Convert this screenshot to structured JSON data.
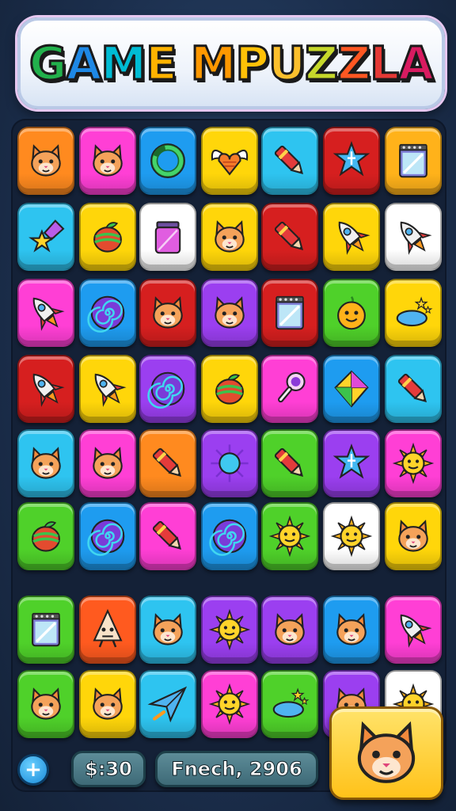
{
  "title": {
    "text": "GAME MPUZZLA",
    "letter_colors": [
      "#22b14c",
      "#1e88e5",
      "#00bcd4",
      "#ffb300",
      "#ff9800",
      "#ffc107",
      "#fbc02d",
      "#c6d82b",
      "#ff5722",
      "#e53935",
      "#d81b60",
      "#c62828"
    ]
  },
  "grid": {
    "columns": 7,
    "rows": [
      [
        {
          "color": "#ff8a1f",
          "icon": "cat-face-icon"
        },
        {
          "color": "#ff3fd5",
          "icon": "cat-face-icon"
        },
        {
          "color": "#1e9cf0",
          "icon": "swirl-ring-icon"
        },
        {
          "color": "#ffd60a",
          "icon": "winged-heart-icon"
        },
        {
          "color": "#2ec4f0",
          "icon": "crayon-icon"
        },
        {
          "color": "#d61f1f",
          "icon": "star-badge-icon"
        },
        {
          "color": "#ffb21a",
          "icon": "notepad-icon"
        }
      ],
      [
        {
          "color": "#2ec4f0",
          "icon": "shooting-star-icon"
        },
        {
          "color": "#ffd60a",
          "icon": "striped-fruit-icon"
        },
        {
          "color": "#ffffff",
          "icon": "jar-icon"
        },
        {
          "color": "#ffd60a",
          "icon": "cat-face-icon"
        },
        {
          "color": "#d61f1f",
          "icon": "crayon-icon"
        },
        {
          "color": "#ffd60a",
          "icon": "rocket-icon"
        },
        {
          "color": "#ffffff",
          "icon": "rocket-icon"
        }
      ],
      [
        {
          "color": "#ff3fd5",
          "icon": "rocket-icon"
        },
        {
          "color": "#1e9cf0",
          "icon": "spiral-icon"
        },
        {
          "color": "#d61f1f",
          "icon": "cat-face-icon"
        },
        {
          "color": "#9b3ff0",
          "icon": "cat-face-icon"
        },
        {
          "color": "#d61f1f",
          "icon": "notepad-icon"
        },
        {
          "color": "#4fd12a",
          "icon": "smiley-sprout-icon"
        },
        {
          "color": "#ffd60a",
          "icon": "cloud-stars-icon"
        }
      ],
      [
        {
          "color": "#d61f1f",
          "icon": "rocket-icon"
        },
        {
          "color": "#ffd60a",
          "icon": "rocket-icon"
        },
        {
          "color": "#9b3ff0",
          "icon": "spiral-icon"
        },
        {
          "color": "#ffd60a",
          "icon": "striped-fruit-icon"
        },
        {
          "color": "#ff3fd5",
          "icon": "rattle-icon"
        },
        {
          "color": "#1e9cf0",
          "icon": "kite-icon"
        },
        {
          "color": "#2ec4f0",
          "icon": "crayon-icon"
        }
      ],
      [
        {
          "color": "#2ec4f0",
          "icon": "cat-face-icon"
        },
        {
          "color": "#ff3fd5",
          "icon": "cat-face-icon"
        },
        {
          "color": "#ff8a1f",
          "icon": "crayon-icon"
        },
        {
          "color": "#9b3ff0",
          "icon": "sun-ball-icon"
        },
        {
          "color": "#4fd12a",
          "icon": "crayon-icon"
        },
        {
          "color": "#9b3ff0",
          "icon": "star-badge-icon"
        },
        {
          "color": "#ff3fd5",
          "icon": "sun-face-icon"
        }
      ],
      [
        {
          "color": "#4fd12a",
          "icon": "striped-fruit-icon"
        },
        {
          "color": "#1e9cf0",
          "icon": "spiral-icon"
        },
        {
          "color": "#ff3fd5",
          "icon": "crayon-icon"
        },
        {
          "color": "#1e9cf0",
          "icon": "spiral-icon"
        },
        {
          "color": "#4fd12a",
          "icon": "sun-face-icon"
        },
        {
          "color": "#ffffff",
          "icon": "sun-face-icon"
        },
        {
          "color": "#ffd60a",
          "icon": "cat-face-icon"
        }
      ],
      [
        {
          "color": "#4fd12a",
          "icon": "notepad-icon"
        },
        {
          "color": "#ff5a1f",
          "icon": "arrowhead-face-icon"
        },
        {
          "color": "#2ec4f0",
          "icon": "cat-face-icon"
        },
        {
          "color": "#9b3ff0",
          "icon": "sun-face-icon"
        },
        {
          "color": "#9b3ff0",
          "icon": "cat-face-icon"
        },
        {
          "color": "#1e9cf0",
          "icon": "cat-face-icon"
        },
        {
          "color": "#ff3fd5",
          "icon": "rocket-icon"
        }
      ],
      [
        {
          "color": "#4fd12a",
          "icon": "cat-face-icon"
        },
        {
          "color": "#ffd60a",
          "icon": "cat-face-icon"
        },
        {
          "color": "#2ec4f0",
          "icon": "paper-plane-icon"
        },
        {
          "color": "#ff3fd5",
          "icon": "sun-face-icon"
        },
        {
          "color": "#4fd12a",
          "icon": "cloud-stars-icon"
        },
        {
          "color": "#9b3ff0",
          "icon": "cat-face-icon"
        },
        {
          "color": "#ffffff",
          "icon": "sun-face-icon"
        }
      ]
    ]
  },
  "selected_tile": {
    "color": "#ffc21a",
    "icon": "cat-face-icon"
  },
  "footer": {
    "add_button_label": "+",
    "timer_label": "$:30",
    "score_label": "Fnech, 2906"
  }
}
